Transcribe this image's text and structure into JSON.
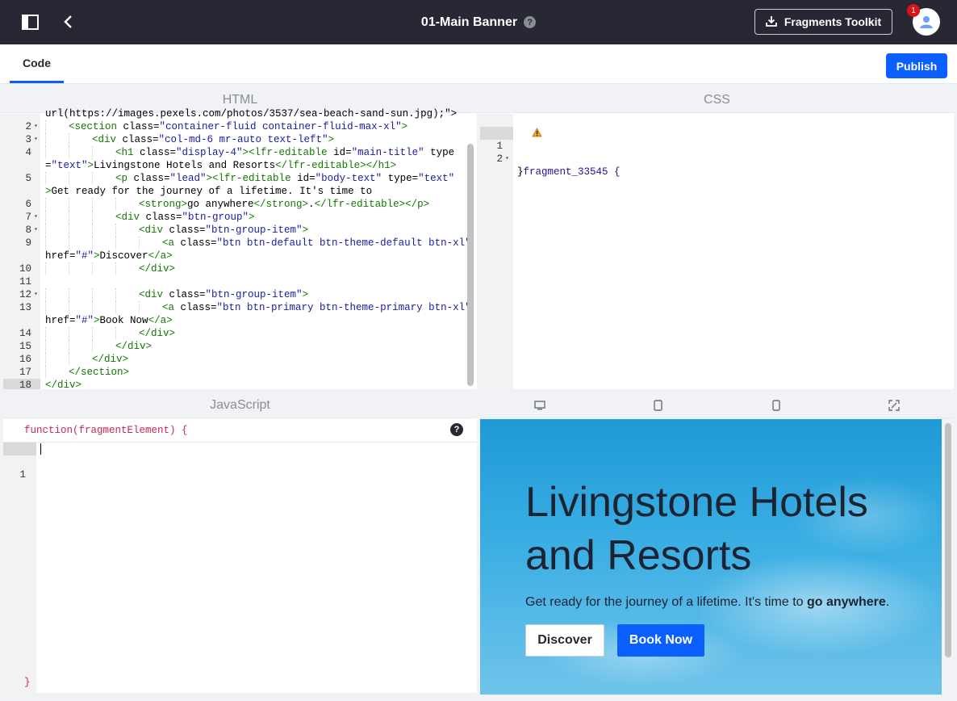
{
  "topbar": {
    "title": "01-Main Banner",
    "help": "?",
    "toolkit_label": "Fragments Toolkit",
    "notification_count": "1"
  },
  "tabs": {
    "code_label": "Code",
    "publish_label": "Publish"
  },
  "html_panel": {
    "header": "HTML",
    "lines": [
      {
        "n": "",
        "fold": false,
        "indent": 0,
        "parts": [
          {
            "c": "tx",
            "t": "url(https://images.pexels.com/photos/3537/sea-beach-sand-sun.jpg);\">"
          }
        ]
      },
      {
        "n": "2",
        "fold": true,
        "indent": 1,
        "parts": [
          {
            "c": "tag",
            "t": "<section"
          },
          {
            "c": "tx",
            "t": " class="
          },
          {
            "c": "str",
            "t": "\"container-fluid container-fluid-max-xl\""
          },
          {
            "c": "tag",
            "t": ">"
          }
        ]
      },
      {
        "n": "3",
        "fold": true,
        "indent": 2,
        "parts": [
          {
            "c": "tag",
            "t": "<div"
          },
          {
            "c": "tx",
            "t": " class="
          },
          {
            "c": "str",
            "t": "\"col-md-6 mr-auto text-left\""
          },
          {
            "c": "tag",
            "t": ">"
          }
        ]
      },
      {
        "n": "4",
        "fold": false,
        "indent": 3,
        "parts": [
          {
            "c": "tag",
            "t": "<h1"
          },
          {
            "c": "tx",
            "t": " class="
          },
          {
            "c": "str",
            "t": "\"display-4\""
          },
          {
            "c": "tag",
            "t": "><lfr-editable"
          },
          {
            "c": "tx",
            "t": " id="
          },
          {
            "c": "str",
            "t": "\"main-title\""
          },
          {
            "c": "tx",
            "t": " type"
          }
        ]
      },
      {
        "n": "",
        "fold": false,
        "indent": 0,
        "parts": [
          {
            "c": "tx",
            "t": "="
          },
          {
            "c": "str",
            "t": "\"text\""
          },
          {
            "c": "tag",
            "t": ">"
          },
          {
            "c": "tx",
            "t": "Livingstone Hotels and Resorts"
          },
          {
            "c": "tag",
            "t": "</lfr-editable></h1>"
          }
        ]
      },
      {
        "n": "5",
        "fold": false,
        "indent": 3,
        "parts": [
          {
            "c": "tag",
            "t": "<p"
          },
          {
            "c": "tx",
            "t": " class="
          },
          {
            "c": "str",
            "t": "\"lead\""
          },
          {
            "c": "tag",
            "t": "><lfr-editable"
          },
          {
            "c": "tx",
            "t": " id="
          },
          {
            "c": "str",
            "t": "\"body-text\""
          },
          {
            "c": "tx",
            "t": " type="
          },
          {
            "c": "str",
            "t": "\"text\""
          }
        ]
      },
      {
        "n": "",
        "fold": false,
        "indent": 0,
        "parts": [
          {
            "c": "tag",
            "t": ">"
          },
          {
            "c": "tx",
            "t": "Get ready for the journey of a lifetime. It's time to"
          }
        ]
      },
      {
        "n": "6",
        "fold": false,
        "indent": 4,
        "parts": [
          {
            "c": "tag",
            "t": "<strong>"
          },
          {
            "c": "tx",
            "t": "go anywhere"
          },
          {
            "c": "tag",
            "t": "</strong>"
          },
          {
            "c": "tx",
            "t": "."
          },
          {
            "c": "tag",
            "t": "</lfr-editable></p>"
          }
        ]
      },
      {
        "n": "7",
        "fold": true,
        "indent": 3,
        "parts": [
          {
            "c": "tag",
            "t": "<div"
          },
          {
            "c": "tx",
            "t": " class="
          },
          {
            "c": "str",
            "t": "\"btn-group\""
          },
          {
            "c": "tag",
            "t": ">"
          }
        ]
      },
      {
        "n": "8",
        "fold": true,
        "indent": 4,
        "parts": [
          {
            "c": "tag",
            "t": "<div"
          },
          {
            "c": "tx",
            "t": " class="
          },
          {
            "c": "str",
            "t": "\"btn-group-item\""
          },
          {
            "c": "tag",
            "t": ">"
          }
        ]
      },
      {
        "n": "9",
        "fold": false,
        "indent": 5,
        "parts": [
          {
            "c": "tag",
            "t": "<a"
          },
          {
            "c": "tx",
            "t": " class="
          },
          {
            "c": "str",
            "t": "\"btn btn-default btn-theme-default btn-xl\""
          }
        ]
      },
      {
        "n": "",
        "fold": false,
        "indent": 0,
        "parts": [
          {
            "c": "tx",
            "t": "href="
          },
          {
            "c": "str",
            "t": "\"#\""
          },
          {
            "c": "tag",
            "t": ">"
          },
          {
            "c": "tx",
            "t": "Discover"
          },
          {
            "c": "tag",
            "t": "</a>"
          }
        ]
      },
      {
        "n": "10",
        "fold": false,
        "indent": 4,
        "parts": [
          {
            "c": "tag",
            "t": "</div>"
          }
        ]
      },
      {
        "n": "11",
        "fold": false,
        "indent": 0,
        "parts": []
      },
      {
        "n": "12",
        "fold": true,
        "indent": 4,
        "parts": [
          {
            "c": "tag",
            "t": "<div"
          },
          {
            "c": "tx",
            "t": " class="
          },
          {
            "c": "str",
            "t": "\"btn-group-item\""
          },
          {
            "c": "tag",
            "t": ">"
          }
        ]
      },
      {
        "n": "13",
        "fold": false,
        "indent": 5,
        "parts": [
          {
            "c": "tag",
            "t": "<a"
          },
          {
            "c": "tx",
            "t": " class="
          },
          {
            "c": "str",
            "t": "\"btn btn-primary btn-theme-primary btn-xl\""
          }
        ]
      },
      {
        "n": "",
        "fold": false,
        "indent": 0,
        "parts": [
          {
            "c": "tx",
            "t": "href="
          },
          {
            "c": "str",
            "t": "\"#\""
          },
          {
            "c": "tag",
            "t": ">"
          },
          {
            "c": "tx",
            "t": "Book Now"
          },
          {
            "c": "tag",
            "t": "</a>"
          }
        ]
      },
      {
        "n": "14",
        "fold": false,
        "indent": 4,
        "parts": [
          {
            "c": "tag",
            "t": "</div>"
          }
        ]
      },
      {
        "n": "15",
        "fold": false,
        "indent": 3,
        "parts": [
          {
            "c": "tag",
            "t": "</div>"
          }
        ]
      },
      {
        "n": "16",
        "fold": false,
        "indent": 2,
        "parts": [
          {
            "c": "tag",
            "t": "</div>"
          }
        ]
      },
      {
        "n": "17",
        "fold": false,
        "indent": 1,
        "parts": [
          {
            "c": "tag",
            "t": "</section>"
          }
        ]
      },
      {
        "n": "18",
        "fold": false,
        "indent": 0,
        "parts": [
          {
            "c": "tag",
            "t": "</div>"
          }
        ]
      }
    ]
  },
  "css_panel": {
    "header": "CSS",
    "line1_num": "1",
    "line2_num": "2",
    "line1_code": ".fragment_33545 {",
    "line2_code": "}"
  },
  "js_panel": {
    "header": "JavaScript",
    "signature": "function(fragmentElement) {",
    "help": "?",
    "line1_num": "1",
    "closing": "}"
  },
  "preview": {
    "hero_title": "Livingstone Hotels and Resorts",
    "lead_text": "Get ready for the journey of a lifetime. It's time to ",
    "lead_strong": "go anywhere",
    "lead_end": ".",
    "discover_label": "Discover",
    "book_label": "Book Now"
  },
  "colors": {
    "topbar": "#272833",
    "accent": "#0b5fff"
  }
}
